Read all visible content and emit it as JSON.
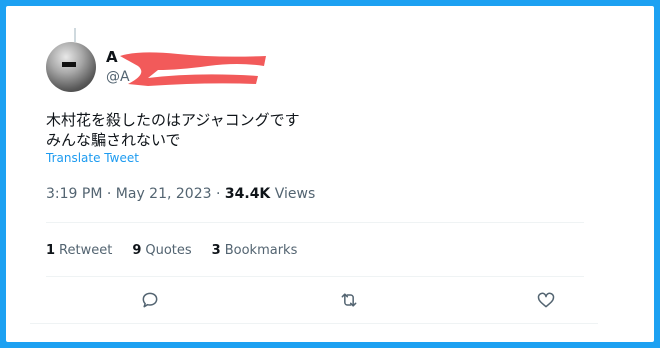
{
  "user": {
    "name_visible": "A",
    "handle_visible": "@A"
  },
  "tweet": {
    "line1": "木村花を殺したのはアジャコングです",
    "line2": "みんな騙されないで",
    "translate_label": "Translate Tweet",
    "time": "3:19 PM",
    "date": "May 21, 2023",
    "views_count": "34.4K",
    "views_label": "Views"
  },
  "stats": {
    "retweets_count": "1",
    "retweets_label": "Retweet",
    "quotes_count": "9",
    "quotes_label": "Quotes",
    "bookmarks_count": "3",
    "bookmarks_label": "Bookmarks"
  },
  "colors": {
    "frame": "#1da1f2",
    "link": "#1d9bf0",
    "redaction": "#f25a5a"
  },
  "icons": [
    "reply-icon",
    "retweet-icon",
    "like-icon"
  ]
}
